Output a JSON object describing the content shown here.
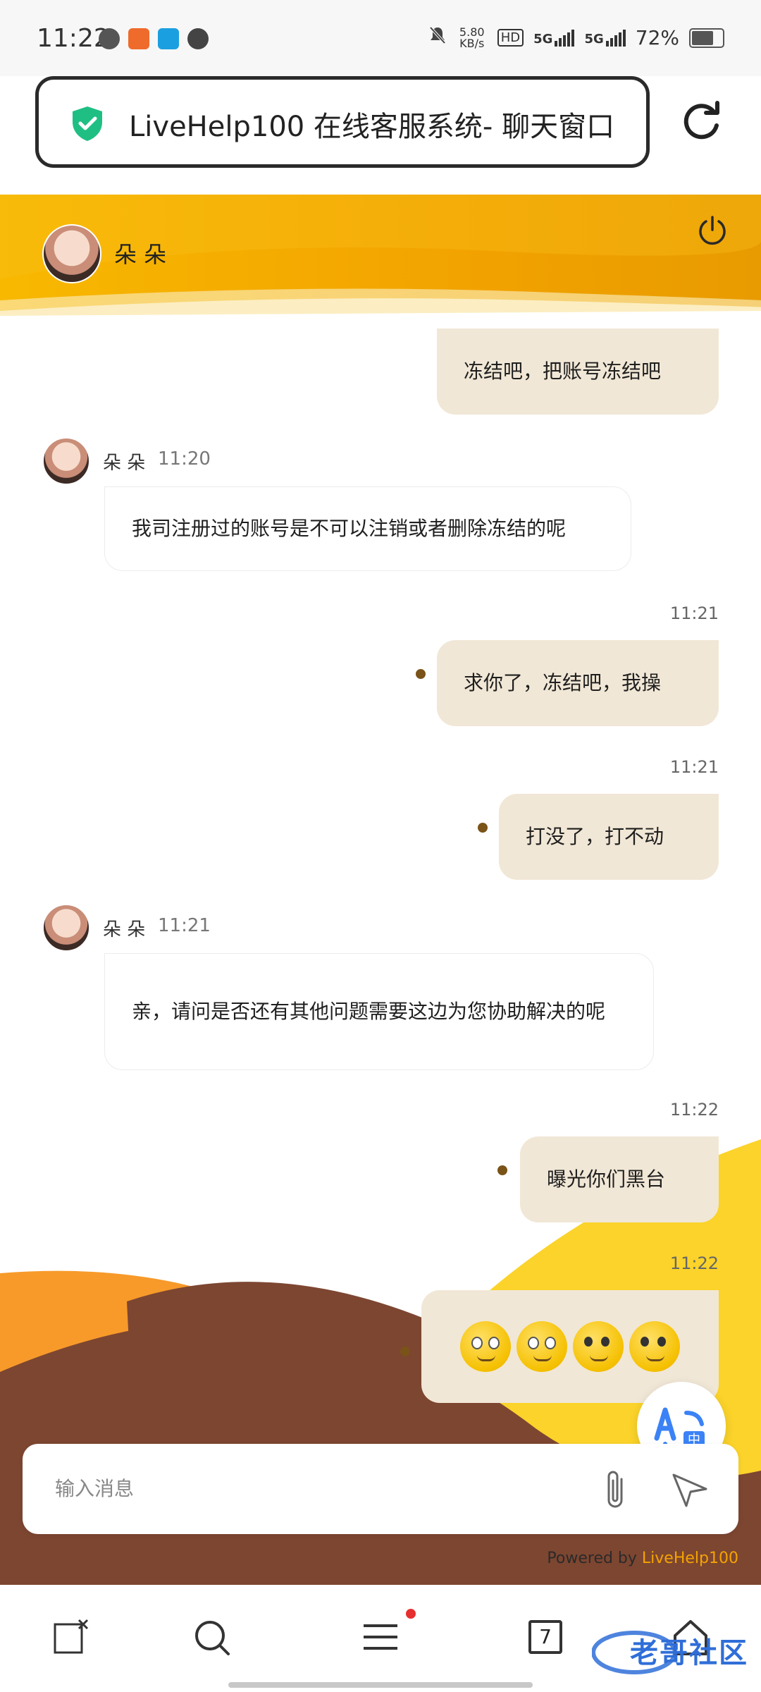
{
  "status_bar": {
    "time": "11:22",
    "net_speed": "5.80 KB/s",
    "hd": "HD",
    "sim1": "5G",
    "sim2": "5G",
    "battery": "72%"
  },
  "browser": {
    "page_title": "LiveHelp100 在线客服系统- 聊天窗口"
  },
  "chat": {
    "agent_name": "朵 朵",
    "messages": [
      {
        "from": "me",
        "text": "冻结吧，把账号冻结吧"
      },
      {
        "from": "agent",
        "name": "朵 朵",
        "time": "11:20",
        "text": "我司注册过的账号是不可以注销或者删除冻结的呢"
      },
      {
        "from": "me",
        "time": "11:21",
        "text": "求你了，冻结吧，我操"
      },
      {
        "from": "me",
        "time": "11:21",
        "text": "打没了，打不动"
      },
      {
        "from": "agent",
        "name": "朵 朵",
        "time": "11:21",
        "text": "亲，请问是否还有其他问题需要这边为您协助解决的呢"
      },
      {
        "from": "me",
        "time": "11:22",
        "text": "曝光你们黑台"
      },
      {
        "from": "me",
        "time": "11:22",
        "text": "🙄🙄🙂🙂"
      }
    ],
    "input_placeholder": "输入消息",
    "powered_by": "Powered by ",
    "brand": "LiveHelp100"
  },
  "bottom_nav": {
    "tabs_count": "7"
  },
  "watermark": "老哥社区",
  "colors": {
    "header": "#f4a900",
    "my_bubble": "#f1e7d6",
    "brand": "#f5a300"
  }
}
